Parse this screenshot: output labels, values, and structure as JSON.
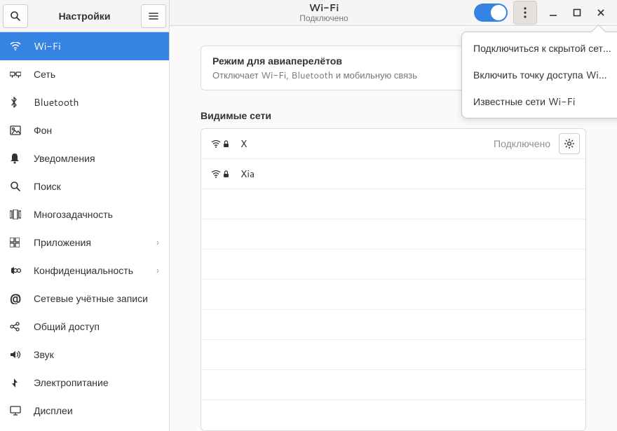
{
  "sidebar": {
    "title": "Настройки",
    "items": [
      {
        "label": "Wi-Fi",
        "icon": "wifi-icon",
        "selected": true
      },
      {
        "label": "Сеть",
        "icon": "network-icon"
      },
      {
        "label": "Bluetooth",
        "icon": "bluetooth-icon"
      },
      {
        "label": "Фон",
        "icon": "background-icon"
      },
      {
        "label": "Уведомления",
        "icon": "notifications-icon"
      },
      {
        "label": "Поиск",
        "icon": "search-icon"
      },
      {
        "label": "Многозадачность",
        "icon": "multitasking-icon"
      },
      {
        "label": "Приложения",
        "icon": "applications-icon",
        "chevron": true
      },
      {
        "label": "Конфиденциальность",
        "icon": "privacy-icon",
        "chevron": true
      },
      {
        "label": "Сетевые учётные записи",
        "icon": "online-accounts-icon"
      },
      {
        "label": "Общий доступ",
        "icon": "sharing-icon"
      },
      {
        "label": "Звук",
        "icon": "sound-icon"
      },
      {
        "label": "Электропитание",
        "icon": "power-icon"
      },
      {
        "label": "Дисплеи",
        "icon": "displays-icon"
      }
    ]
  },
  "header": {
    "title": "Wi-Fi",
    "subtitle": "Подключено",
    "wifi_enabled": true
  },
  "airplane": {
    "title": "Режим для авиаперелётов",
    "subtitle": "Отключает Wi-Fi, Bluetooth и мобильную связь"
  },
  "visible_section_label": "Видимые сети",
  "networks": [
    {
      "name": "X",
      "secured": true,
      "status": "Подключено",
      "settings": true
    },
    {
      "name": "Xia",
      "secured": true
    }
  ],
  "popover": {
    "items": [
      "Подключиться к скрытой сети…",
      "Включить точку доступа Wi-Fi…",
      "Известные сети Wi-Fi"
    ]
  }
}
